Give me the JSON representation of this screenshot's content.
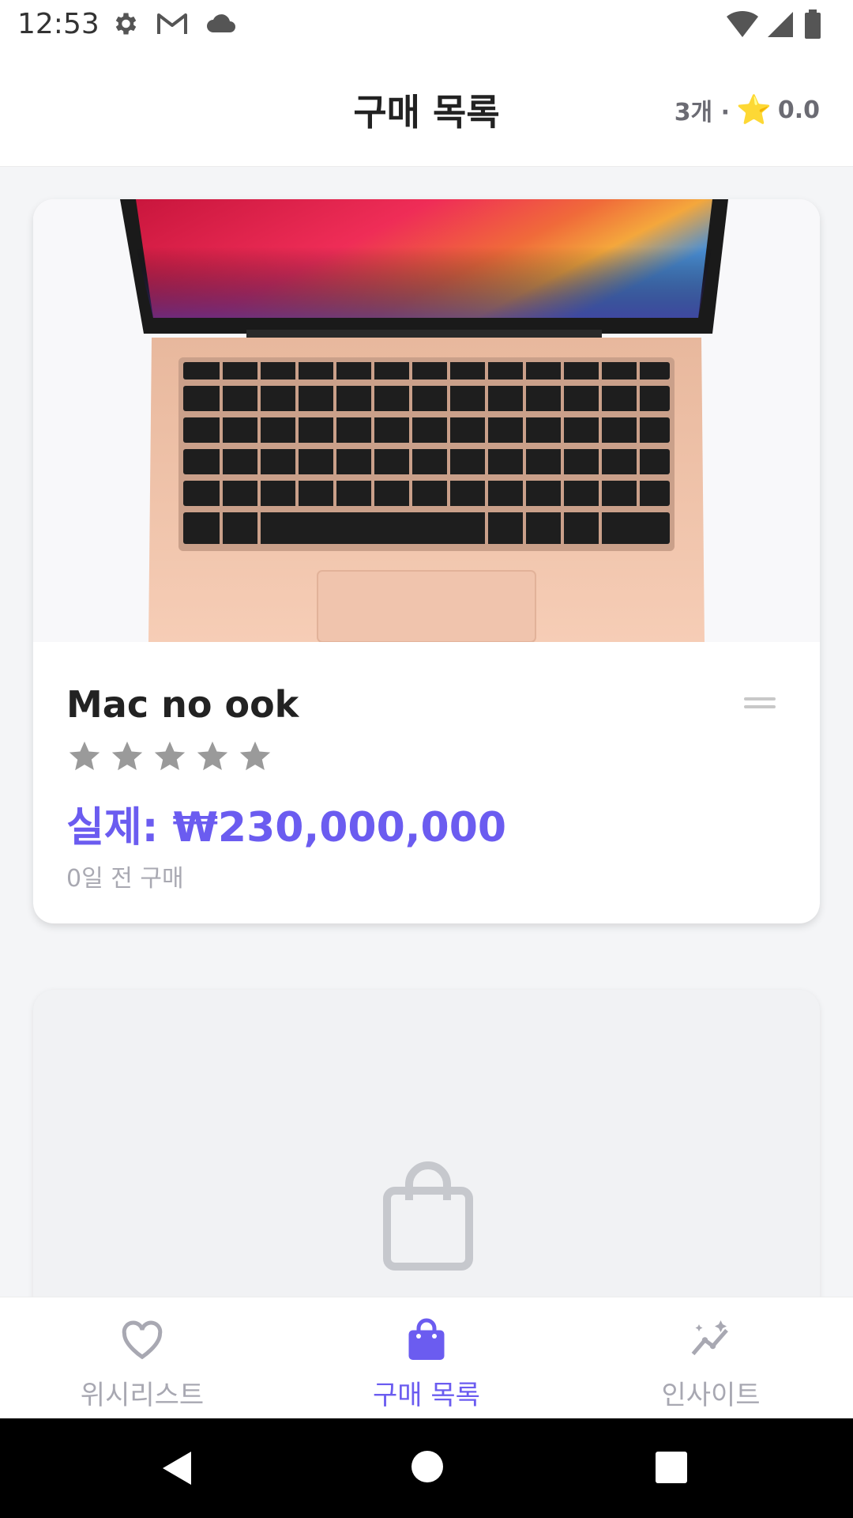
{
  "status_bar": {
    "time": "12:53",
    "left_icons": [
      "gear-icon",
      "gmail-icon",
      "cloud-icon"
    ],
    "right_icons": [
      "wifi-icon",
      "cell-signal-icon",
      "battery-icon"
    ]
  },
  "header": {
    "title": "구매 목록",
    "summary_count": "3개 ·",
    "summary_star": "⭐",
    "summary_rating": "0.0"
  },
  "purchases": [
    {
      "name": "Mac no ook",
      "rating_stars": 0,
      "rating_max": 5,
      "price_label": "실제: ₩230,000,000",
      "date_label": "0일 전 구매",
      "image": "laptop-image"
    }
  ],
  "placeholder_card": {
    "icon": "shopping-bag-icon"
  },
  "bottom_nav": {
    "items": [
      {
        "label": "위시리스트",
        "icon": "heart-icon",
        "active": false
      },
      {
        "label": "구매 목록",
        "icon": "shopping-bag-icon",
        "active": true
      },
      {
        "label": "인사이트",
        "icon": "sparkle-chart-icon",
        "active": false
      }
    ]
  },
  "colors": {
    "accent": "#6b5cf0",
    "inactive": "#a8a8b2",
    "star_empty": "#9a9a9a",
    "star_filled": "#f6b40e"
  },
  "system_nav": {
    "icons": [
      "back-icon",
      "home-icon",
      "recents-icon"
    ]
  }
}
